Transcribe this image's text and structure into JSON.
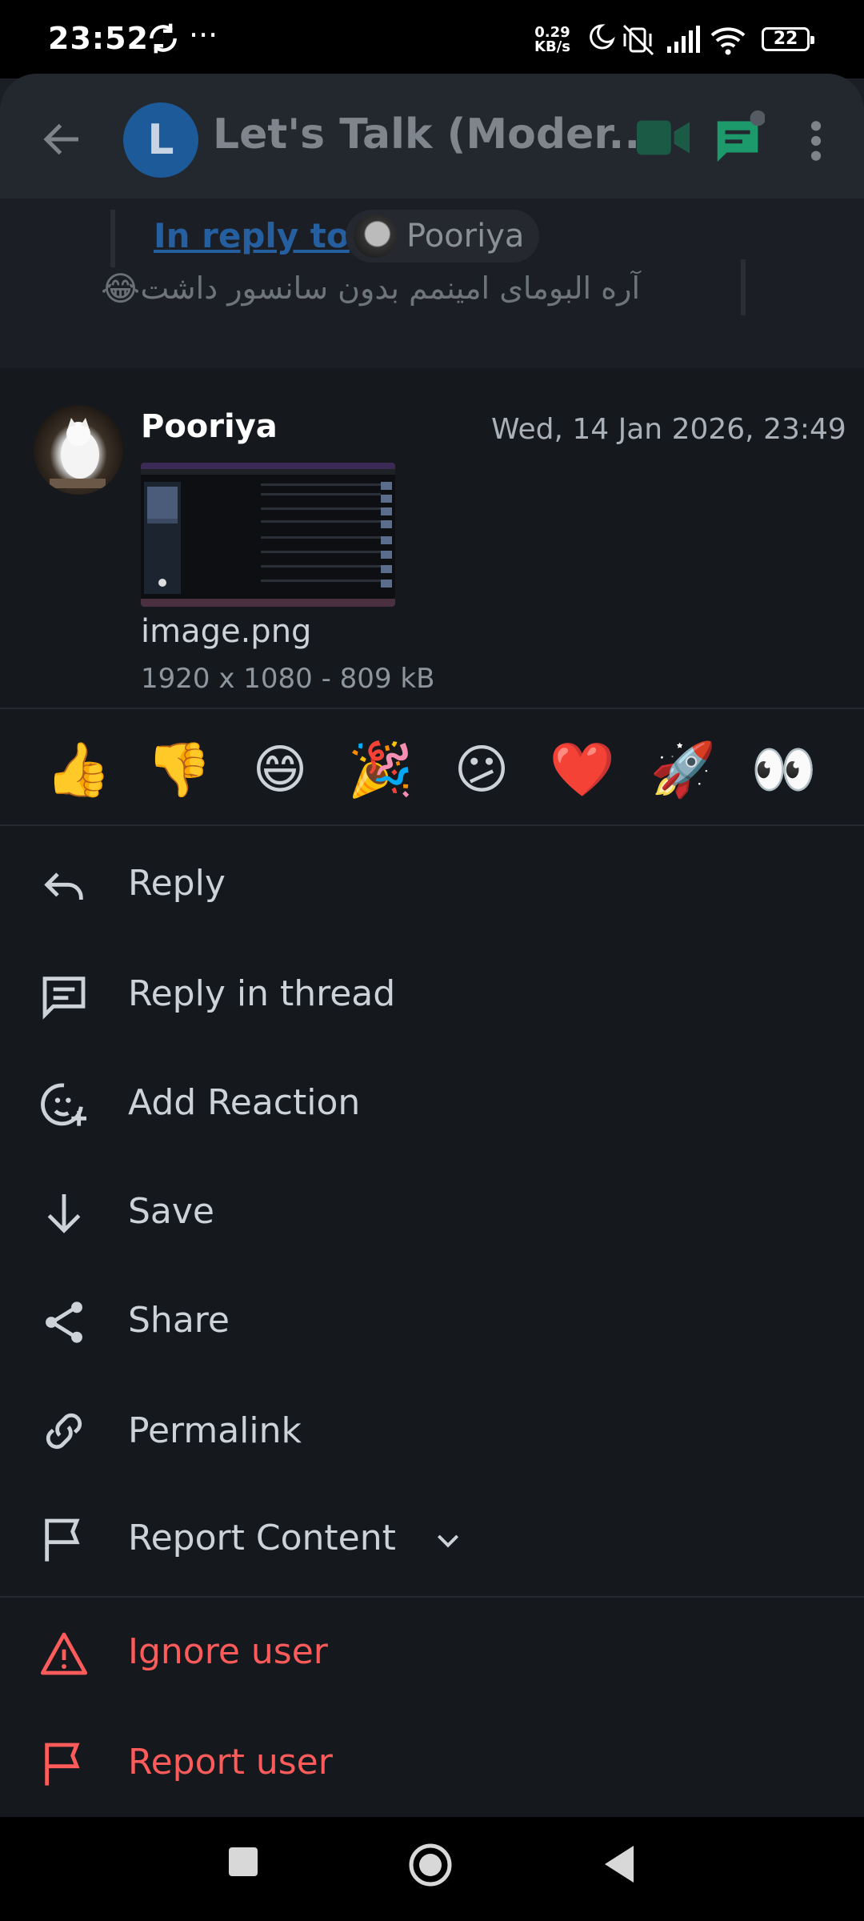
{
  "status_bar": {
    "time": "23:52",
    "dots": "···",
    "speed_top": "0.29",
    "speed_bottom": "KB/s",
    "battery": "22"
  },
  "header": {
    "avatar_letter": "L",
    "title": "Let's Talk (Moder..."
  },
  "background_message": {
    "in_reply_to": "In reply to",
    "reply_name": "Pooriya",
    "text": "آره البومای امینمم بدون سانسور داشت",
    "emoji": "😂"
  },
  "message": {
    "sender": "Pooriya",
    "timestamp": "Wed, 14 Jan 2026, 23:49",
    "file_name": "image.png",
    "file_meta": "1920 x 1080 - 809 kB"
  },
  "reactions": [
    "👍",
    "👎",
    "😄",
    "🎉",
    "😕",
    "❤️",
    "🚀",
    "👀"
  ],
  "menu": {
    "reply": "Reply",
    "reply_in_thread": "Reply in thread",
    "add_reaction": "Add Reaction",
    "save": "Save",
    "share": "Share",
    "permalink": "Permalink",
    "report_content": "Report Content",
    "ignore_user": "Ignore user",
    "report_user": "Report user"
  },
  "icons": {
    "reply": "reply-arrow-icon",
    "thread": "thread-icon",
    "reaction": "add-reaction-icon",
    "save": "download-arrow-icon",
    "share": "share-icon",
    "permalink": "link-icon",
    "report": "flag-icon",
    "ignore": "warning-icon"
  },
  "colors": {
    "accent_link": "#255f9f",
    "danger": "#ff5b5b",
    "thread_green": "#1d9a6c",
    "background": "#15191e"
  }
}
